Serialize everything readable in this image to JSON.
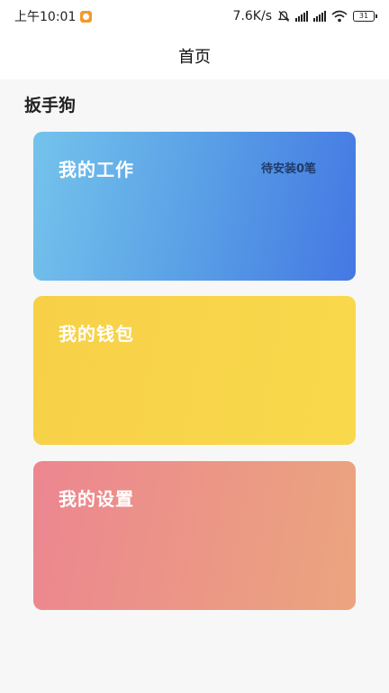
{
  "status_bar": {
    "time": "上午10:01",
    "speed": "7.6K/s",
    "battery": "31"
  },
  "nav": {
    "title": "首页"
  },
  "section": {
    "title": "扳手狗"
  },
  "cards": [
    {
      "title": "我的工作",
      "badge": "待安装0笔"
    },
    {
      "title": "我的钱包"
    },
    {
      "title": "我的设置"
    }
  ],
  "colors": {
    "work_gradient": [
      "#74c3ec",
      "#4478e3"
    ],
    "wallet_gradient": [
      "#f7d048",
      "#f9d94c"
    ],
    "settings_gradient": [
      "#ec8690",
      "#eba57e"
    ]
  }
}
